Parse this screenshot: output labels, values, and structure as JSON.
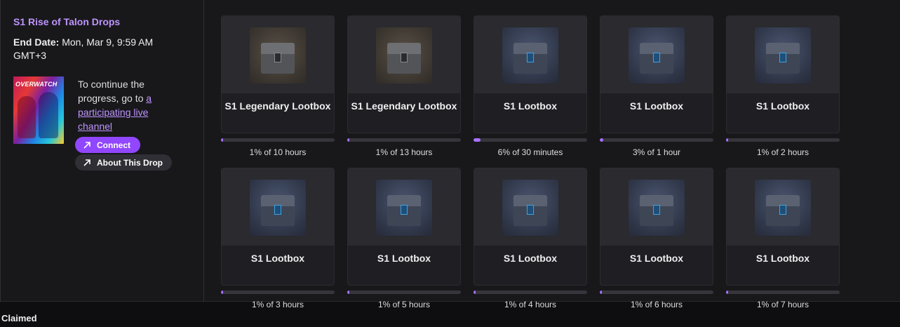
{
  "campaign": {
    "title": "S1 Rise of Talon Drops",
    "end_date_label": "End Date:",
    "end_date_value": "Mon, Mar 9, 9:59 AM GMT+3",
    "game_logo_text": "OVERWATCH",
    "continue_text": "To continue the progress, go to",
    "continue_link": "a participating live channel",
    "connect_label": "Connect",
    "about_label": "About This Drop"
  },
  "drops": [
    {
      "name": "S1 Legendary Lootbox",
      "kind": "legendary",
      "progress_text": "1% of 10 hours",
      "progress_pct": 1
    },
    {
      "name": "S1 Legendary Lootbox",
      "kind": "legendary",
      "progress_text": "1% of 13 hours",
      "progress_pct": 1
    },
    {
      "name": "S1 Lootbox",
      "kind": "basic",
      "progress_text": "6% of 30 minutes",
      "progress_pct": 6
    },
    {
      "name": "S1 Lootbox",
      "kind": "basic",
      "progress_text": "3% of 1 hour",
      "progress_pct": 3
    },
    {
      "name": "S1 Lootbox",
      "kind": "basic",
      "progress_text": "1% of 2 hours",
      "progress_pct": 1
    },
    {
      "name": "S1 Lootbox",
      "kind": "basic",
      "progress_text": "1% of 3 hours",
      "progress_pct": 1
    },
    {
      "name": "S1 Lootbox",
      "kind": "basic",
      "progress_text": "1% of 5 hours",
      "progress_pct": 1
    },
    {
      "name": "S1 Lootbox",
      "kind": "basic",
      "progress_text": "1% of 4 hours",
      "progress_pct": 1
    },
    {
      "name": "S1 Lootbox",
      "kind": "basic",
      "progress_text": "1% of 6 hours",
      "progress_pct": 1
    },
    {
      "name": "S1 Lootbox",
      "kind": "basic",
      "progress_text": "1% of 7 hours",
      "progress_pct": 1
    }
  ],
  "claimed_heading": "Claimed",
  "colors": {
    "accent": "#9147ff",
    "title": "#bf94ff",
    "progress": "#a970ff"
  }
}
